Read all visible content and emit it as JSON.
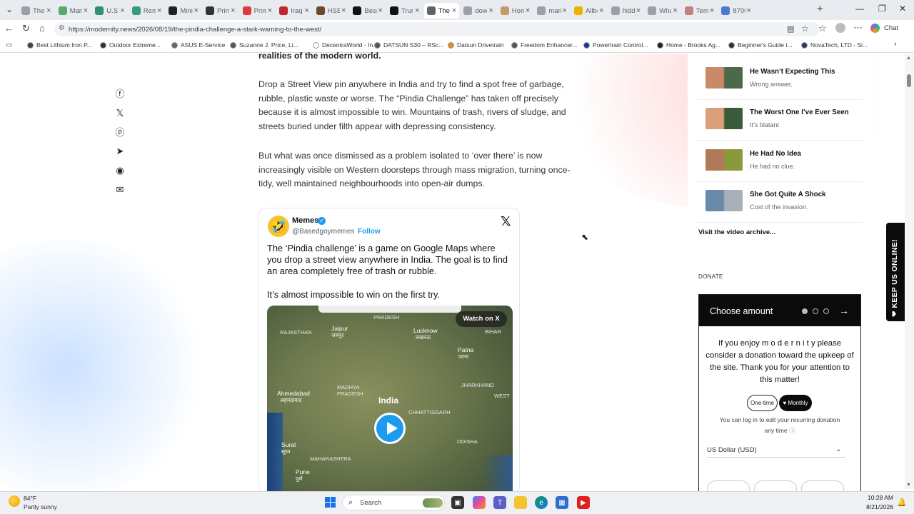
{
  "tabs": [
    {
      "label": "The I",
      "color": "#9aa0a6",
      "close": "×",
      "active": false
    },
    {
      "label": "Mari",
      "color": "#5aa86a",
      "close": "×",
      "active": false
    },
    {
      "label": "U.S. I",
      "color": "#2f8f6f",
      "close": "×",
      "active": false
    },
    {
      "label": "Rem",
      "color": "#3a9a7a",
      "close": "×",
      "active": false
    },
    {
      "label": "Mini",
      "color": "#222222",
      "close": "×",
      "active": false
    },
    {
      "label": "Prim",
      "color": "#333333",
      "close": "×",
      "active": false
    },
    {
      "label": "Prim",
      "color": "#e03a3a",
      "close": "×",
      "active": false
    },
    {
      "label": "Iraqi",
      "color": "#c0262d",
      "close": "×",
      "active": false
    },
    {
      "label": "HSBC",
      "color": "#6a4a2a",
      "close": "×",
      "active": false
    },
    {
      "label": "Bessi",
      "color": "#111111",
      "close": "×",
      "active": false
    },
    {
      "label": "Trum",
      "color": "#111111",
      "close": "×",
      "active": false
    },
    {
      "label": "The",
      "color": "#5f6368",
      "close": "×",
      "active": true
    },
    {
      "label": "dow",
      "color": "#9aa0a6",
      "close": "×",
      "active": false
    },
    {
      "label": "Hom",
      "color": "#c49a6c",
      "close": "×",
      "active": false
    },
    {
      "label": "mari",
      "color": "#9aa0a6",
      "close": "×",
      "active": false
    },
    {
      "label": "Allbe",
      "color": "#e6b400",
      "close": "×",
      "active": false
    },
    {
      "label": "hidd",
      "color": "#9aa0a6",
      "close": "×",
      "active": false
    },
    {
      "label": "Wha",
      "color": "#9aa0a6",
      "close": "×",
      "active": false
    },
    {
      "label": "Temi",
      "color": "#c08080",
      "close": "×",
      "active": false
    },
    {
      "label": "8700",
      "color": "#4a7acc",
      "close": "×",
      "active": false
    }
  ],
  "browser": {
    "url": "https://modernity.news/2026/08/19/the-pindia-challenge-a-stark-warning-to-the-west/",
    "new_tab": "+",
    "chat_label": "Chat"
  },
  "bookmarks": [
    {
      "label": "Best Lithium Iron P...",
      "color": "#444444"
    },
    {
      "label": "Outdoor Extreme...",
      "color": "#333333"
    },
    {
      "label": "ASUS E-Service",
      "color": "#666666"
    },
    {
      "label": "Suzanne J. Price, Li...",
      "color": "#555555"
    },
    {
      "label": "DecentraWorld - In...",
      "color": "#ffffff"
    },
    {
      "label": "DATSUN S30 – RSc...",
      "color": "#555555"
    },
    {
      "label": "Datsun Drivetrain",
      "color": "#e08a2a"
    },
    {
      "label": "Freedom Enhancer...",
      "color": "#555555"
    },
    {
      "label": "Powertrain Control...",
      "color": "#1a3a8a"
    },
    {
      "label": "Home - Brooks Ag...",
      "color": "#222222"
    },
    {
      "label": "Beginner's Guide t...",
      "color": "#333333"
    },
    {
      "label": "NovaTech, LTD - Si...",
      "color": "#2a3a5a"
    }
  ],
  "article": {
    "cut_heading": "realities of the modern world.",
    "para1": "Drop a Street View pin anywhere in India and try to find a spot free of garbage, rubble, plastic waste or worse. The “Pindia Challenge” has taken off precisely because it is almost impossible to win. Mountains of trash, rivers of sludge, and streets buried under filth appear with depressing consistency.",
    "para2": "But what was once dismissed as a problem isolated to ‘over there’ is now increasingly visible on Western doorsteps through mass migration, turning once-tidy, well maintained neighbourhoods into open-air dumps."
  },
  "tweet": {
    "avatar": "🤣",
    "name": "Memes",
    "verified": "✓",
    "handle": "@Basedgoymemes",
    "follow": "Follow",
    "x_logo": "𝕏",
    "text1": "The ‘Pindia challenge’ is a game on Google Maps where you drop a street view anywhere in India. The goal is to find an area completely free of trash or rubble.",
    "text2": "It’s almost impossible to win on the first try.",
    "watch_on": "Watch on X",
    "map_labels": {
      "pradesh": "PRADESH",
      "rajasthan": "RAJASTHAN",
      "jaipur": "Jaipur",
      "jaipur_hi": "जयपुर",
      "lucknow": "Lucknow",
      "lucknow_hi": "लखनऊ",
      "patna": "Patna",
      "patna_hi": "पटना",
      "bihar": "BIHAR",
      "madhya": "MADHYA",
      "pradesh2": "PRADESH",
      "jharkhand": "JHARKHAND",
      "ahmedabad": "Ahmedabad",
      "ahmedabad_hi": "अहमदाबाद",
      "india": "India",
      "west": "WEST",
      "chhattisgarh": "CHHATTISGARH",
      "surat": "Surat",
      "surat_hi": "सूरत",
      "odisha": "ODISHA",
      "maharashtra": "MAHARASHTRA",
      "pune": "Pune",
      "pune_hi": "पुणे"
    }
  },
  "sidebar": {
    "videos": [
      {
        "title": "He Wasn’t Expecting This",
        "subtitle": "Wrong answer."
      },
      {
        "title": "The Worst One I’ve Ever Seen",
        "subtitle": "It’s blatant"
      },
      {
        "title": "He Had No Idea",
        "subtitle": "He had no clue."
      },
      {
        "title": "She Got Quite A Shock",
        "subtitle": "Cost of the invasion."
      }
    ],
    "archive": "Visit the video archive..."
  },
  "donate": {
    "label": "DONATE",
    "title": "Choose amount",
    "arrow": "→",
    "text": "If you enjoy m o d e r n i t y please consider a donation toward the upkeep of the site. Thank you for your attention to this matter!",
    "one_time": "One-time",
    "monthly": "♥ Monthly",
    "login": "You can log in to edit your recurring donation any time",
    "currency": "US Dollar (USD)"
  },
  "keep_us_online": "❤ KEEP US ONLINE!",
  "taskbar": {
    "temp": "84°F",
    "weather": "Partly sunny",
    "search": "Search",
    "time": "10:28 AM",
    "date": "8/21/2026"
  }
}
